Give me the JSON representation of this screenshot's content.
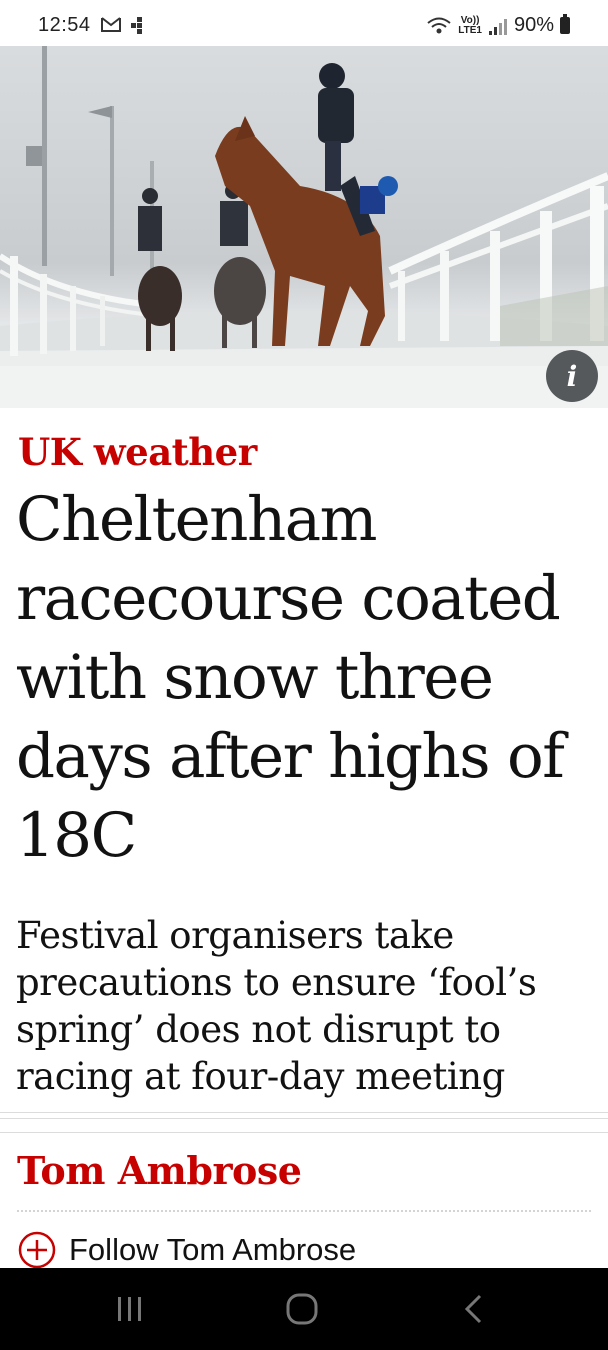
{
  "status_bar": {
    "time": "12:54",
    "network_label_top": "Vo))",
    "network_label_bottom": "LTE1",
    "battery": "90%",
    "icons": [
      "gmail-icon",
      "dots-icon",
      "wifi-icon",
      "signal-icon",
      "battery-icon"
    ]
  },
  "hero": {
    "info_label": "i",
    "icon": "info-icon"
  },
  "article": {
    "kicker": "UK weather",
    "headline": "Cheltenham racecourse coated with snow three days after highs of 18C",
    "standfirst": "Festival organisers take precautions to ensure ‘fool’s spring’ does not disrupt to racing at four-day meeting",
    "byline": "Tom Ambrose",
    "follow_label": "Follow Tom Ambrose"
  },
  "colors": {
    "accent_red": "#c70000",
    "text": "#121212",
    "nav_bar": "#000000"
  },
  "nav_bar": {
    "icons": [
      "recent-apps-icon",
      "home-icon",
      "back-icon"
    ]
  }
}
